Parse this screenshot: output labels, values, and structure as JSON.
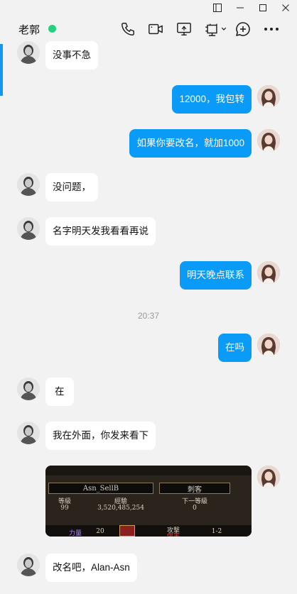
{
  "window": {
    "controls": [
      "sidebar-toggle",
      "minimize",
      "maximize",
      "close"
    ]
  },
  "header": {
    "contact_name": "老郭",
    "online_color": "#26d17d",
    "icons": [
      "phone-icon",
      "video-icon",
      "screen-share-icon",
      "remote-assist-icon",
      "add-chat-icon",
      "more-icon"
    ]
  },
  "messages": [
    {
      "side": "in",
      "text": "没事不急"
    },
    {
      "side": "out",
      "text": "12000，我包转"
    },
    {
      "side": "out",
      "text": "如果你要改名，就加1000"
    },
    {
      "side": "in",
      "text": "没问题，"
    },
    {
      "side": "in",
      "text": "名字明天发我看看再说"
    },
    {
      "side": "out",
      "text": "明天晚点联系"
    },
    {
      "side": "out",
      "text": "在吗"
    },
    {
      "side": "in",
      "text": "在"
    },
    {
      "side": "in",
      "text": "我在外面，你发来看下"
    },
    {
      "side": "out",
      "type": "image"
    },
    {
      "side": "in",
      "text": "改名吧，Alan-Asn"
    }
  ],
  "timestamp": "20:37",
  "image": {
    "name": "Asn_SellB",
    "class": "刺客",
    "level_label": "等級",
    "level": "99",
    "exp_label": "經驗",
    "exp": "3,520,485,254",
    "next_label": "下一等級",
    "next": "0",
    "strength_label": "力量",
    "strength": "20",
    "damage_label": "攻撃",
    "damage_sub": "傷害",
    "damage": "1-2"
  },
  "colors": {
    "outgoing_bubble": "#0a9af7",
    "incoming_bubble": "#ffffff",
    "background": "#f2f2f2",
    "accent": "#1296f0"
  }
}
